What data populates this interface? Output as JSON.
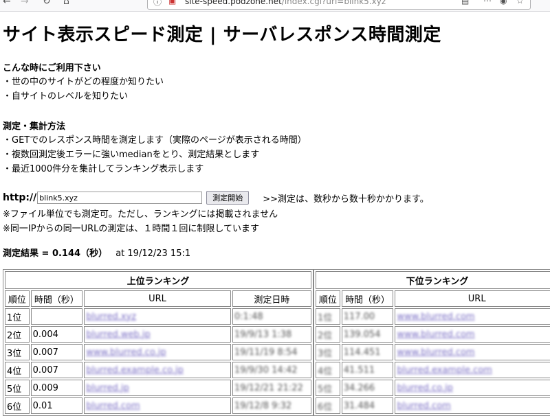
{
  "browser": {
    "url_host": "site-speed.podzone.net",
    "url_path": "/index.cgi?url=blink5.xyz"
  },
  "page": {
    "title": "サイト表示スピード測定 | サーバレスポンス時間測定",
    "section1_title": "こんな時にご利用下さい",
    "section1_lines": [
      "・世の中のサイトがどの程度か知りたい",
      "・自サイトのレベルを知りたい"
    ],
    "section2_title": "測定・集計方法",
    "section2_lines": [
      "・GETでのレスポンス時間を測定します（実際のページが表示される時間）",
      "・複数回測定後エラーに強いmedianをとり、測定結果とします",
      "・最近1000件分を集計してランキング表示します"
    ]
  },
  "form": {
    "prefix": "http://",
    "input_value": "blink5.xyz",
    "submit_label": "測定開始",
    "note": ">>測定は、数秒から数十秒かかります。",
    "notes_below": [
      "※ファイル単位でも測定可。ただし、ランキングには掲載されません",
      "※同一IPからの同一URLの測定は、１時間１回に制限しています"
    ]
  },
  "result": {
    "label": "測定結果 = 0.144（秒）",
    "at": "at 19/12/23 15:1"
  },
  "top_ranking": {
    "caption": "上位ランキング",
    "headers": [
      "順位",
      "時間（秒）",
      "URL",
      "測定日時"
    ],
    "rows": [
      {
        "rank": "1位",
        "time": "",
        "url": "blurred.xyz",
        "date": "0:1:48"
      },
      {
        "rank": "2位",
        "time": "0.004",
        "url": "blurred.web.jp",
        "date": "19/9/13 1:38"
      },
      {
        "rank": "3位",
        "time": "0.007",
        "url": "www.blurred.co.jp",
        "date": "19/11/19 8:54"
      },
      {
        "rank": "4位",
        "time": "0.007",
        "url": "blurred.example.co.jp",
        "date": "19/9/30 14:42"
      },
      {
        "rank": "5位",
        "time": "0.009",
        "url": "blurred.jp",
        "date": "19/12/21 21:22"
      },
      {
        "rank": "6位",
        "time": "0.01",
        "url": "blurred.com",
        "date": "19/12/8 9:32"
      }
    ]
  },
  "bottom_ranking": {
    "caption": "下位ランキング",
    "headers": [
      "順位",
      "時間（秒）",
      "URL"
    ],
    "rows": [
      {
        "rank": "1位",
        "time": "117.00",
        "url": "www.blurred.com"
      },
      {
        "rank": "2位",
        "time": "139.054",
        "url": "www.blurred.com"
      },
      {
        "rank": "3位",
        "time": "114.451",
        "url": "www.blurred.com"
      },
      {
        "rank": "4位",
        "time": "41.511",
        "url": "blurred.example.com"
      },
      {
        "rank": "5位",
        "time": "34.266",
        "url": "blurred.co.jp"
      },
      {
        "rank": "6位",
        "time": "31.484",
        "url": "blurred.com"
      }
    ]
  }
}
